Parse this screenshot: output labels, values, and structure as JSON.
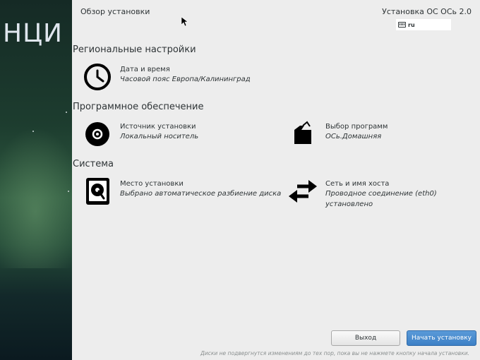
{
  "sidebar": {
    "logo_text": "НЦИ"
  },
  "header": {
    "page_title": "Обзор установки",
    "product_title": "Установка ОС ОСь 2.0",
    "keyboard_layout": "ru"
  },
  "sections": {
    "regional": {
      "title": "Региональные настройки",
      "datetime": {
        "name": "Дата и время",
        "status": "Часовой пояс Европа/Калининград",
        "icon": "clock-icon"
      }
    },
    "software": {
      "title": "Программное обеспечение",
      "source": {
        "name": "Источник установки",
        "status": "Локальный носитель",
        "icon": "disc-icon"
      },
      "selection": {
        "name": "Выбор программ",
        "status": "ОСь.Домашняя",
        "icon": "package-icon"
      }
    },
    "system": {
      "title": "Система",
      "destination": {
        "name": "Место установки",
        "status": "Выбрано автоматическое разбиение диска",
        "icon": "harddisk-icon"
      },
      "network": {
        "name": "Сеть и имя хоста",
        "status": "Проводное соединение (eth0) установлено",
        "icon": "network-arrows-icon"
      }
    }
  },
  "buttons": {
    "exit": "Выход",
    "start": "Начать установку"
  },
  "footnote": "Диски не подвергнутся изменениям до тех пор, пока вы не нажмете кнопку начала установки.",
  "colors": {
    "accent": "#3d80c6",
    "background": "#ededed"
  }
}
